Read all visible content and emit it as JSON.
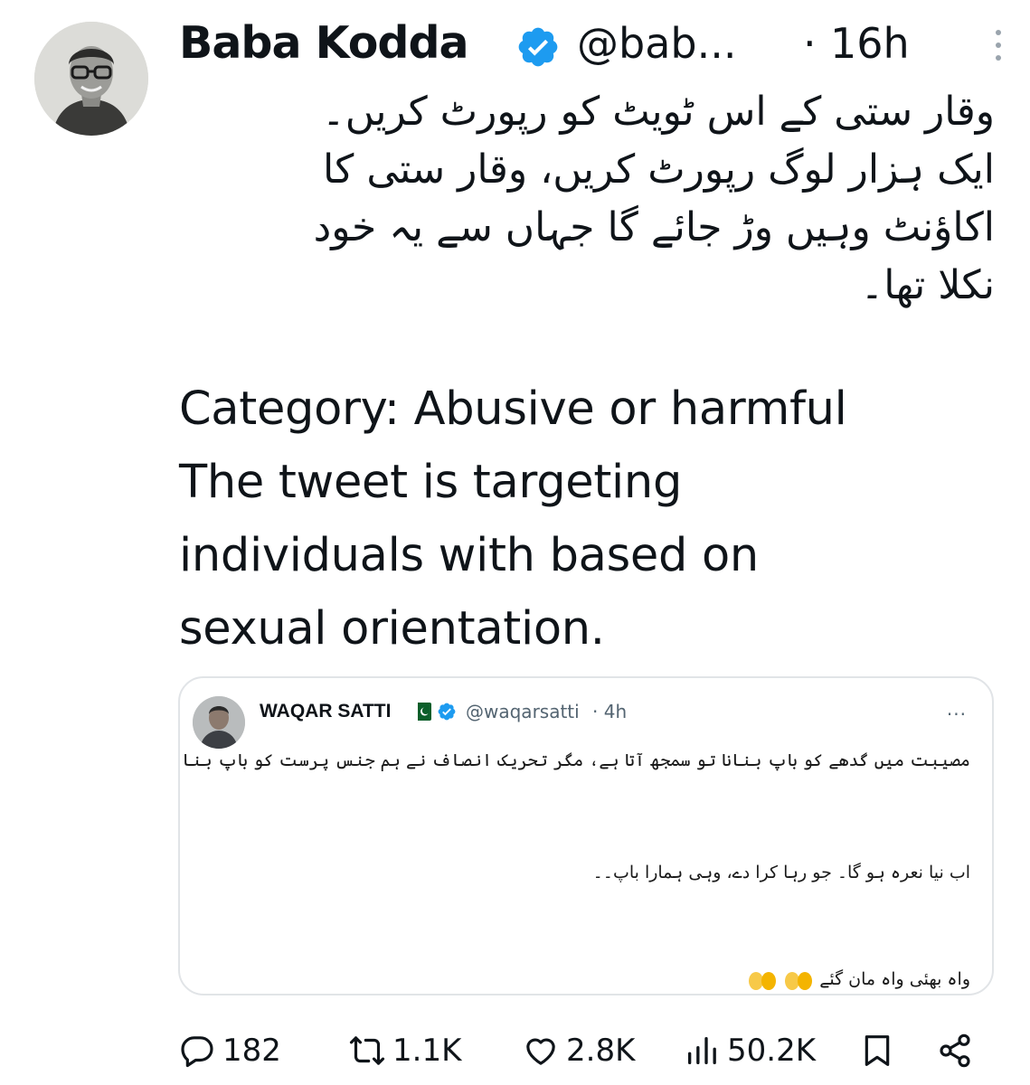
{
  "author": {
    "name": "Baba Kodda",
    "handle": "@bab...",
    "separator": "·",
    "time": "16h",
    "verified": true,
    "badge_color": "#1d9bf0"
  },
  "tweet": {
    "urdu_lines": [
      "وقار ستی کے اس ٹویٹ کو رپورٹ کریں۔",
      "ایک ہزار لوگ رپورٹ کریں، وقار ستی کا",
      "اکاؤنٹ وہیں وڑ جائے گا جہاں سے یہ خود",
      "نکلا تھا۔"
    ],
    "english_lines": [
      "Category: Abusive or harmful",
      "The tweet is targeting",
      "individuals with based on",
      "sexual orientation."
    ]
  },
  "quoted": {
    "name": "WAQAR SATTI",
    "handle": "@waqarsatti",
    "separator": "·",
    "time": "4h",
    "flag": "pakistan-flag-icon",
    "verified": true,
    "more": "···",
    "line1": "مصیبت میں گدھے کو باپ بنانا تو سمجھ آتا ہے، مگر تحریک انصاف نے ہم جنس پرست کو باپ بنا کر نئی مثال قائم کر دی ہے۔",
    "line2": "اب نیا نعرہ ہو گا۔ جو رہا کرا دے، وہی ہمارا باپ۔۔",
    "line3": "واہ بھئی واہ مان گئے",
    "emoji": "clapping-hands-icon"
  },
  "actions": {
    "replies": "182",
    "reposts": "1.1K",
    "likes": "2.8K",
    "views": "50.2K"
  }
}
